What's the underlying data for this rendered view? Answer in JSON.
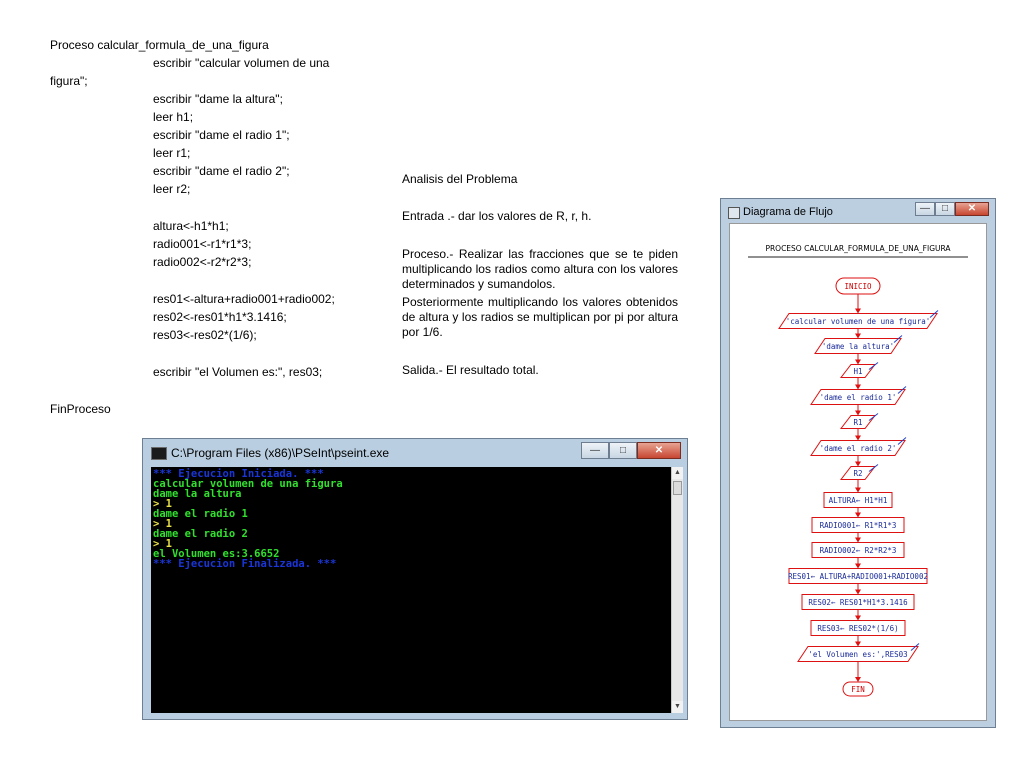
{
  "code": {
    "lines": [
      "Proceso calcular_formula_de_una_figura",
      "escribir \"calcular volumen de una",
      "figura\";",
      "escribir \"dame la altura\";",
      "leer h1;",
      "escribir \"dame el radio 1\";",
      "leer r1;",
      "escribir \"dame el radio 2\";",
      "leer r2;",
      "altura<-h1*h1;",
      "radio001<-r1*r1*3;",
      "radio002<-r2*r2*3;",
      "res01<-altura+radio001+radio002;",
      "res02<-res01*h1*3.1416;",
      "res03<-res02*(1/6);",
      "escribir \"el Volumen es:\", res03;",
      "FinProceso"
    ]
  },
  "analysis": {
    "heading": "Analisis del Problema",
    "entrada": "Entrada .- dar  los valores de R, r, h.",
    "proceso": "Proceso.- Realizar las fracciones que se te piden multiplicando los radios como altura con los valores determinados y sumandolos.",
    "posterior": "Posteriormente multiplicando los valores obtenidos de altura y los radios se multiplican por pi por altura por 1/6.",
    "salida": "Salida.- El resultado total."
  },
  "console": {
    "title": "C:\\Program Files (x86)\\PSeInt\\pseint.exe",
    "lines": [
      {
        "text": "*** Ejecucion Iniciada. ***",
        "color": "#1a35d8"
      },
      {
        "text": "calcular volumen de una figura",
        "color": "#31e02e"
      },
      {
        "text": "dame la altura",
        "color": "#31e02e"
      },
      {
        "text": "> 1",
        "color": "#e8e04a"
      },
      {
        "text": "dame el radio 1",
        "color": "#31e02e"
      },
      {
        "text": "> 1",
        "color": "#e8e04a"
      },
      {
        "text": "dame el radio 2",
        "color": "#31e02e"
      },
      {
        "text": "> 1",
        "color": "#e8e04a"
      },
      {
        "text": "el Volumen es:3.6652",
        "color": "#31e02e"
      },
      {
        "text": "*** Ejecucion Finalizada. ***",
        "color": "#1a35d8"
      }
    ],
    "buttons": {
      "minimize": "—",
      "maximize": "□",
      "close": "✕"
    }
  },
  "flow": {
    "window_title": "Diagrama de Flujo",
    "diagram_title": "PROCESO CALCULAR_FORMULA_DE_UNA_FIGURA",
    "nodes": [
      {
        "kind": "terminal",
        "text": "INICIO"
      },
      {
        "kind": "output",
        "text": "'calcular volumen de una figura'"
      },
      {
        "kind": "output",
        "text": "'dame la altura'"
      },
      {
        "kind": "input",
        "text": "H1"
      },
      {
        "kind": "output",
        "text": "'dame el radio 1'"
      },
      {
        "kind": "input",
        "text": "R1"
      },
      {
        "kind": "output",
        "text": "'dame el radio 2'"
      },
      {
        "kind": "input",
        "text": "R2"
      },
      {
        "kind": "process",
        "text": "ALTURA← H1*H1"
      },
      {
        "kind": "process",
        "text": "RADIO001← R1*R1*3"
      },
      {
        "kind": "process",
        "text": "RADIO002← R2*R2*3"
      },
      {
        "kind": "process",
        "text": "RES01← ALTURA+RADIO001+RADIO002"
      },
      {
        "kind": "process",
        "text": "RES02← RES01*H1*3.1416"
      },
      {
        "kind": "process",
        "text": "RES03← RES02*(1/6)"
      },
      {
        "kind": "output",
        "text": "'el Volumen es:',RES03"
      },
      {
        "kind": "terminal",
        "text": "FIN"
      }
    ],
    "buttons": {
      "minimize": "—",
      "maximize": "□",
      "close": "✕"
    }
  }
}
